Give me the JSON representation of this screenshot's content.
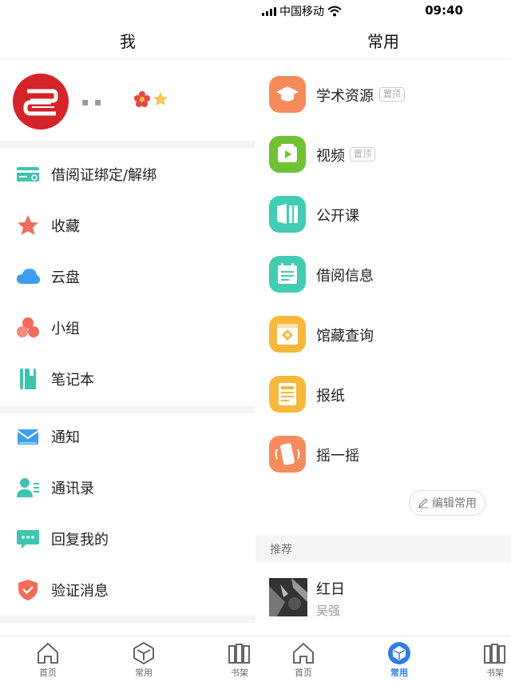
{
  "left": {
    "title": "我",
    "profile": {
      "username": "▪ ▪"
    },
    "menu_group1": [
      {
        "label": "借阅证绑定/解绑",
        "icon": "library-card-icon",
        "color": "#3fc4b0"
      },
      {
        "label": "收藏",
        "icon": "star-icon",
        "color": "#f26b5b"
      },
      {
        "label": "云盘",
        "icon": "cloud-icon",
        "color": "#3d9ef0"
      },
      {
        "label": "小组",
        "icon": "group-icon",
        "color": "#f26b5b"
      },
      {
        "label": "笔记本",
        "icon": "notebook-icon",
        "color": "#3fc4b0"
      }
    ],
    "menu_group2": [
      {
        "label": "通知",
        "icon": "mail-icon",
        "color": "#3d9ef0"
      },
      {
        "label": "通讯录",
        "icon": "contacts-icon",
        "color": "#3fc4b0"
      },
      {
        "label": "回复我的",
        "icon": "chat-icon",
        "color": "#3fc4b0"
      },
      {
        "label": "验证消息",
        "icon": "shield-check-icon",
        "color": "#f26b5b"
      }
    ]
  },
  "right": {
    "status": {
      "carrier": "中国移动",
      "time": "09:40"
    },
    "title": "常用",
    "items": [
      {
        "label": "学术资源",
        "tag": "置顶",
        "icon": "graduation-cap-icon",
        "color": "#f58b5c"
      },
      {
        "label": "视频",
        "tag": "置顶",
        "icon": "video-play-icon",
        "color": "#6ec234"
      },
      {
        "label": "公开课",
        "tag": "",
        "icon": "open-course-icon",
        "color": "#41cdb1"
      },
      {
        "label": "借阅信息",
        "tag": "",
        "icon": "borrow-calendar-icon",
        "color": "#41cdb1"
      },
      {
        "label": "馆藏查询",
        "tag": "",
        "icon": "collection-search-icon",
        "color": "#f5b83a"
      },
      {
        "label": "报纸",
        "tag": "",
        "icon": "newspaper-icon",
        "color": "#f5b83a"
      },
      {
        "label": "摇一摇",
        "tag": "",
        "icon": "shake-phone-icon",
        "color": "#f58b5c"
      }
    ],
    "edit_label": "编辑常用",
    "recommend_label": "推荐",
    "recommend": {
      "title": "红日",
      "author": "吴强"
    }
  },
  "tabs": [
    {
      "label": "首页",
      "icon": "home-icon"
    },
    {
      "label": "常用",
      "icon": "cube-icon"
    },
    {
      "label": "书架",
      "icon": "bookshelf-icon"
    }
  ],
  "colors": {
    "accent": "#2f7ce6",
    "avatar_red": "#d4242a"
  }
}
